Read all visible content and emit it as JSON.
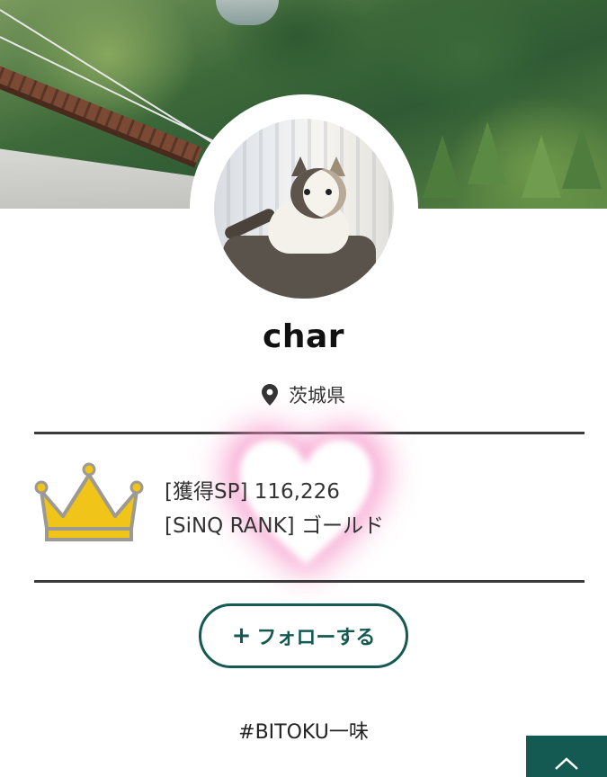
{
  "profile": {
    "username": "char",
    "location": "茨城県",
    "hashtag": "#BITOKU一味"
  },
  "rank": {
    "sp_label": "[獲得SP]",
    "sp_value": "116,226",
    "rank_label": "[SiNQ RANK]",
    "rank_value": "ゴールド"
  },
  "actions": {
    "follow_label": "フォローする",
    "follow_plus": "+"
  },
  "colors": {
    "accent": "#155a52",
    "crown": "#f0c419",
    "heart_glow": "#f48fc4"
  },
  "icons": {
    "location": "location-pin-icon",
    "rank": "crown-icon",
    "scroll_top": "chevron-up-icon"
  }
}
